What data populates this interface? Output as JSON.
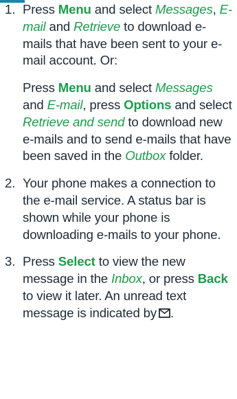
{
  "steps": [
    {
      "number": "1.",
      "paragraphs": [
        [
          {
            "s": "t",
            "text": "Press "
          },
          {
            "s": "b",
            "text": "Menu"
          },
          {
            "s": "t",
            "text": " and select "
          },
          {
            "s": "i",
            "text": "Messages"
          },
          {
            "s": "t",
            "text": ", "
          },
          {
            "s": "i",
            "text": "E-mail"
          },
          {
            "s": "t",
            "text": " and "
          },
          {
            "s": "i",
            "text": "Retrieve"
          },
          {
            "s": "t",
            "text": " to download e-mails that have been sent to your e-mail account. Or:"
          }
        ],
        [
          {
            "s": "t",
            "text": "Press "
          },
          {
            "s": "b",
            "text": "Menu"
          },
          {
            "s": "t",
            "text": " and select "
          },
          {
            "s": "i",
            "text": "Messages"
          },
          {
            "s": "t",
            "text": " and "
          },
          {
            "s": "i",
            "text": "E-mail"
          },
          {
            "s": "t",
            "text": ", press "
          },
          {
            "s": "b",
            "text": "Options"
          },
          {
            "s": "t",
            "text": " and select "
          },
          {
            "s": "i",
            "text": "Retrieve and send"
          },
          {
            "s": "t",
            "text": " to download new e-mails and to send e-mails that have been saved in the "
          },
          {
            "s": "i",
            "text": "Outbox"
          },
          {
            "s": "t",
            "text": " folder."
          }
        ]
      ]
    },
    {
      "number": "2.",
      "paragraphs": [
        [
          {
            "s": "t",
            "text": "Your phone makes a connection to the e-mail service. A status bar is shown while your phone is downloading e-mails to your phone."
          }
        ]
      ]
    },
    {
      "number": "3.",
      "paragraphs": [
        [
          {
            "s": "t",
            "text": "Press "
          },
          {
            "s": "b",
            "text": "Select"
          },
          {
            "s": "t",
            "text": " to view the new message in the "
          },
          {
            "s": "i",
            "text": "Inbox"
          },
          {
            "s": "t",
            "text": ", or press "
          },
          {
            "s": "b",
            "text": "Back"
          },
          {
            "s": "t",
            "text": " to view it later. An unread text message is indicated by"
          },
          {
            "s": "icon",
            "icon": "envelope-icon"
          },
          {
            "s": "t",
            "text": "."
          }
        ]
      ]
    }
  ],
  "colors": {
    "accent": "#1c9b4d",
    "text": "#1f2a35",
    "top_bar": "#1a86ad"
  }
}
